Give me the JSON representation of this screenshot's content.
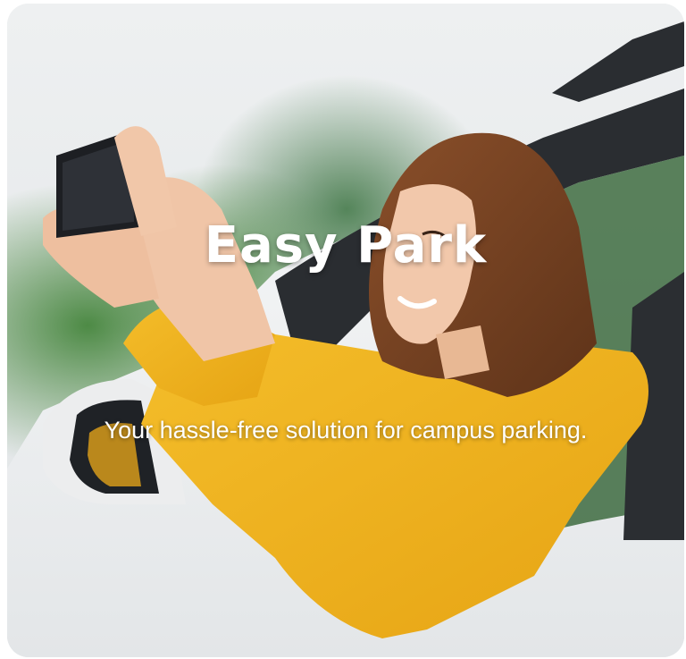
{
  "hero": {
    "title": "Easy Park",
    "subtitle": "Your hassle-free solution for campus parking.",
    "image": "woman-in-car-taking-photo"
  },
  "colors": {
    "title_text": "#ffffff",
    "sweater": "#f0b21f",
    "car_body": "#f3f4f5",
    "foliage": "#3f7a3a"
  }
}
